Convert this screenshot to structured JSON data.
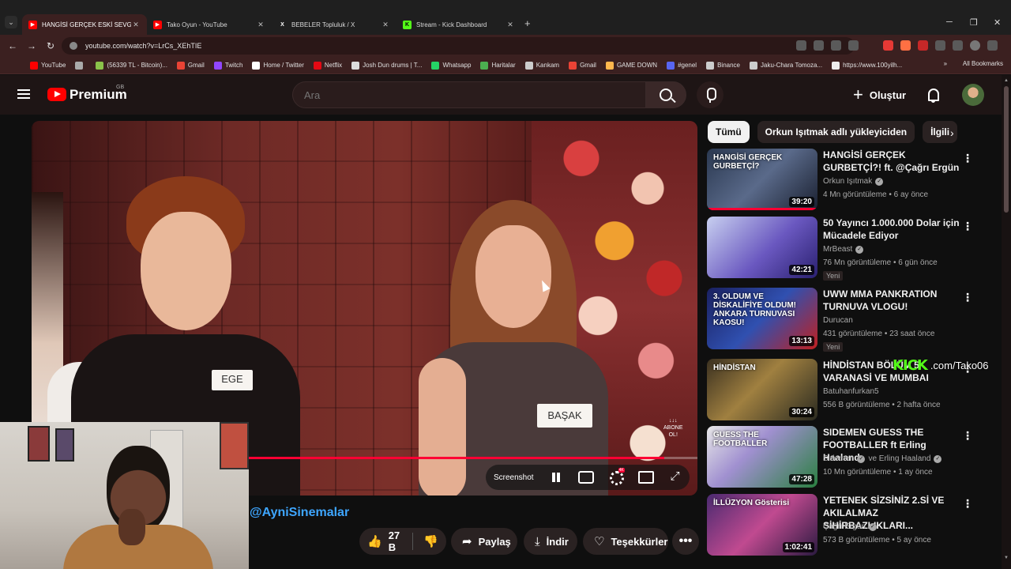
{
  "browser": {
    "tabs": [
      {
        "title": "HANGİSİ GERÇEK ESKİ SEVGİLİ?",
        "favicon": "youtube-icon",
        "active": true
      },
      {
        "title": "Tako Oyun - YouTube",
        "favicon": "youtube-icon",
        "active": false
      },
      {
        "title": "BEBELER Topluluk / X",
        "favicon": "x-icon",
        "active": false
      },
      {
        "title": "Stream - Kick Dashboard",
        "favicon": "kick-icon",
        "active": false
      }
    ],
    "new_tab_glyph": "+",
    "close_glyph": "✕",
    "window_controls": [
      "─",
      "❐",
      "✕"
    ],
    "url": "youtube.com/watch?v=LrCs_XEhTIE",
    "nav_glyphs": {
      "back": "←",
      "forward": "→",
      "reload": "↻"
    },
    "bookmarks": [
      {
        "label": "YouTube",
        "color": "#ff0000"
      },
      {
        "label": "",
        "color": "#aaaaaa"
      },
      {
        "label": "(56339 TL - Bitcoin)...",
        "color": "#8bc34a"
      },
      {
        "label": "Gmail",
        "color": "#ea4335"
      },
      {
        "label": "Twitch",
        "color": "#9146ff"
      },
      {
        "label": "Home / Twitter",
        "color": "#ffffff"
      },
      {
        "label": "Netflix",
        "color": "#e50914"
      },
      {
        "label": "Josh Dun drums | T...",
        "color": "#dddddd"
      },
      {
        "label": "Whatsapp",
        "color": "#25d366"
      },
      {
        "label": "Haritalar",
        "color": "#4caf50"
      },
      {
        "label": "Kankam",
        "color": "#cccccc"
      },
      {
        "label": "Gmail",
        "color": "#ea4335"
      },
      {
        "label": "GAME DOWN",
        "color": "#ffb74d"
      },
      {
        "label": "#genel",
        "color": "#5865f2"
      },
      {
        "label": "Binance",
        "color": "#cccccc"
      },
      {
        "label": "Jaku-Chara Tomoza...",
        "color": "#cccccc"
      },
      {
        "label": "https://www.100yilh...",
        "color": "#eeeeee"
      }
    ],
    "more_bookmarks_glyph": "»",
    "all_bookmarks": "All Bookmarks"
  },
  "youtube": {
    "brand": "Premium",
    "region": "GB",
    "search_placeholder": "Ara",
    "create_label": "Oluştur",
    "create_glyph": "+"
  },
  "player": {
    "name_tag_left": "EGE",
    "name_tag_right": "BAŞAK",
    "subscribe_overlay": "↓↓↓\nABONE\nOL!",
    "progress": 0.95,
    "screenshot_label": "Screenshot"
  },
  "video": {
    "channel_handle": "@AyniSinemalar",
    "likes": "27 B",
    "share_label": "Paylaş",
    "download_label": "İndir",
    "thanks_label": "Teşekkürler",
    "glyphs": {
      "like": "👍",
      "dislike": "👎",
      "share": "➦",
      "download": "⤓",
      "thanks": "♡",
      "more": "•••"
    }
  },
  "chips": [
    "Tümü",
    "Orkun Işıtmak adlı yükleyiciden",
    "İlgili"
  ],
  "chip_next_glyph": "›",
  "recommendations": [
    {
      "title": "HANGİSİ GERÇEK GURBETÇİ?! ft. @Çağrı Ergün",
      "channel": "Orkun Işıtmak",
      "verified": true,
      "meta": "4 Mn görüntüleme • 6 ay önce",
      "duration": "39:20",
      "thumb_text": "HANGİSİ GERÇEK GURBETÇİ?",
      "badge": "",
      "watched": 1.0
    },
    {
      "title": "50 Yayıncı 1.000.000 Dolar için Mücadele Ediyor",
      "channel": "MrBeast",
      "verified": true,
      "meta": "76 Mn görüntüleme • 6 gün önce",
      "duration": "42:21",
      "thumb_text": "",
      "badge": "Yeni",
      "watched": 0
    },
    {
      "title": "UWW MMA PANKRATION TURNUVA VLOGU!",
      "channel": "Durucan",
      "verified": false,
      "meta": "431 görüntüleme • 23 saat önce",
      "duration": "13:13",
      "thumb_text": "3. OLDUM VE DİSKALİFİYE OLDUM! ANKARA TURNUVASI KAOSU!",
      "badge": "Yeni",
      "watched": 0
    },
    {
      "title": "HİNDİSTAN BÖLÜM 5 VARANASİ VE MUMBAI",
      "channel": "Batuhanfurkan5",
      "verified": false,
      "meta": "556 B görüntüleme • 2 hafta önce",
      "duration": "30:24",
      "thumb_text": "HİNDİSTAN",
      "badge": "",
      "watched": 0
    },
    {
      "title": "SIDEMEN GUESS THE FOOTBALLER ft Erling Haaland",
      "channel": "Sidemen",
      "channel2": "ve Erling Haaland",
      "verified": true,
      "meta": "10 Mn görüntüleme • 1 ay önce",
      "duration": "47:28",
      "thumb_text": "GUESS THE FOOTBALLER",
      "badge": "",
      "watched": 0
    },
    {
      "title": "YETENEK SİZSİNİZ 2.Sİ VE AKILALMAZ SİHİRBAZLIKLARI...",
      "channel": "Çağrı Ergün",
      "verified": true,
      "meta": "573 B görüntüleme • 5 ay önce",
      "duration": "1:02:41",
      "thumb_text": "İLLÜZYON Gösterisi",
      "badge": "",
      "watched": 0
    }
  ],
  "menu_glyph": "⋮",
  "verified_glyph": "✓",
  "overlay": {
    "kick_logo": "KICK",
    "kick_url": ".com/Tako06"
  },
  "colors": {
    "accent": "#ff0033",
    "link": "#3ea6ff",
    "kick": "#53fc18",
    "header_tint": "#3b2020"
  }
}
